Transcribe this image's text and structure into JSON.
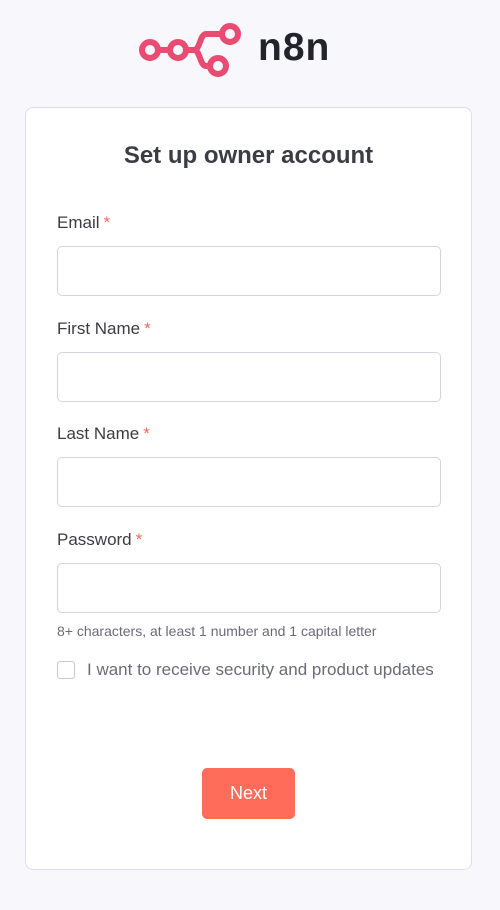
{
  "logo": {
    "text": "n8n",
    "mark_icon": "n8n-logo-icon",
    "color": "#ea4b71"
  },
  "form": {
    "title": "Set up owner account",
    "required_marker": "*",
    "fields": [
      {
        "label": "Email",
        "value": "",
        "placeholder": ""
      },
      {
        "label": "First Name",
        "value": "",
        "placeholder": ""
      },
      {
        "label": "Last Name",
        "value": "",
        "placeholder": ""
      },
      {
        "label": "Password",
        "value": "",
        "placeholder": ""
      }
    ],
    "password_hint": "8+ characters, at least 1 number and 1 capital letter",
    "updates_checkbox": {
      "label": "I want to receive security and product updates",
      "checked": false
    },
    "submit_label": "Next"
  },
  "colors": {
    "accent": "#ff6d5a",
    "required": "#f06b58",
    "background": "#f8f8fc"
  }
}
